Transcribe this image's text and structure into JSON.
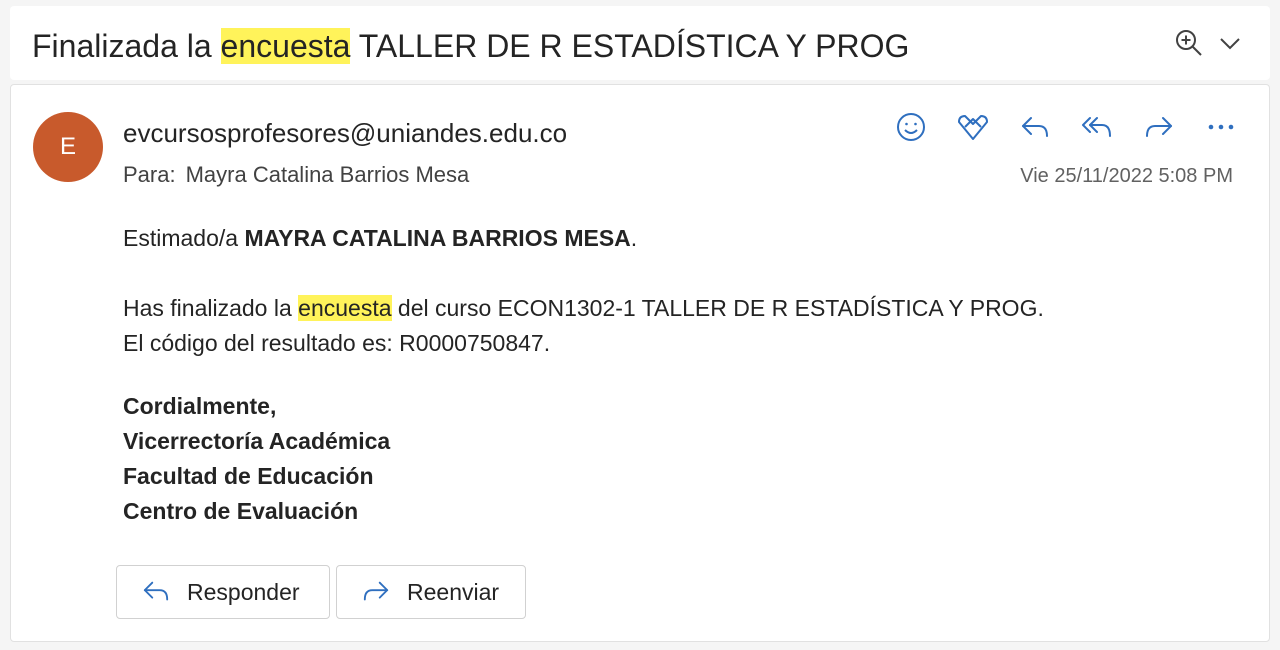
{
  "subject": {
    "before": "Finalizada la ",
    "highlight": "encuesta",
    "after": " TALLER DE R ESTADÍSTICA Y PROG"
  },
  "subject_tools": {
    "zoom_icon": "zoom-in-icon",
    "expand_icon": "chevron-down-icon"
  },
  "message": {
    "avatar_initial": "E",
    "sender": "evcursosprofesores@uniandes.edu.co",
    "to_label": "Para:",
    "to_name": "Mayra Catalina Barrios Mesa",
    "date": "Vie 25/11/2022 5:08 PM",
    "actions": [
      "smiley-icon",
      "heart-icon",
      "reply-icon",
      "reply-all-icon",
      "forward-icon",
      "more-icon"
    ]
  },
  "body": {
    "greeting_prefix": "Estimado/a ",
    "greeting_name": "MAYRA CATALINA BARRIOS MESA",
    "greeting_suffix": ".",
    "line1_before": "Has finalizado la ",
    "line1_highlight": "encuesta",
    "line1_after": " del curso ECON1302-1 TALLER DE R ESTADÍSTICA Y PROG.",
    "line2": "El código del resultado es: R0000750847.",
    "signature": [
      "Cordialmente,",
      "Vicerrectoría Académica",
      "Facultad de Educación",
      "Centro de Evaluación"
    ]
  },
  "buttons": {
    "reply_label": "Responder",
    "forward_label": "Reenviar"
  },
  "colors": {
    "accent": "#2f6fbf",
    "avatar": "#c85a2c",
    "highlight": "#fff35a"
  }
}
